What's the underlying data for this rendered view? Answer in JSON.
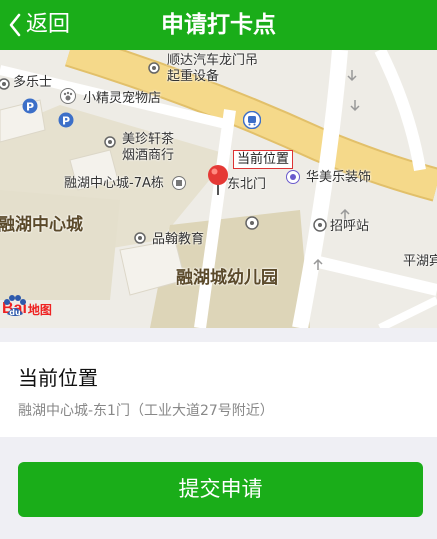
{
  "header": {
    "back_label": "返回",
    "title": "申请打卡点"
  },
  "map": {
    "labels": {
      "shunda": "顺达汽车龙门吊",
      "qizhong": "起重设备",
      "duoleshi": "多乐士",
      "petshop": "小精灵宠物店",
      "meizhen1": "美珍轩茶",
      "meizhen2": "烟酒商行",
      "bldg7a": "融湖中心城-7A栋",
      "east_gate": "东北门",
      "huamei": "华美乐装饰",
      "center_city": "融湖中心城",
      "pinhan": "品翰教育",
      "zhaohu": "招呼站",
      "kindergarten": "融湖城幼儿园",
      "pingyong": "平湖宾"
    },
    "pin_tag": "当前位置",
    "logo_bai": "Bai",
    "logo_map": "地图"
  },
  "location": {
    "title": "当前位置",
    "address": "融湖中心城-东1门（工业大道27号附近）"
  },
  "submit_label": "提交申请",
  "colors": {
    "brand_green": "#1aad19",
    "road_yellow": "#f5d98a",
    "pin_red": "#e53935"
  },
  "icons": [
    "chevron-left-icon",
    "location-pin-icon",
    "parking-icon",
    "bus-stop-icon",
    "paw-icon",
    "poi-dot-icon",
    "baidu-logo-icon"
  ]
}
